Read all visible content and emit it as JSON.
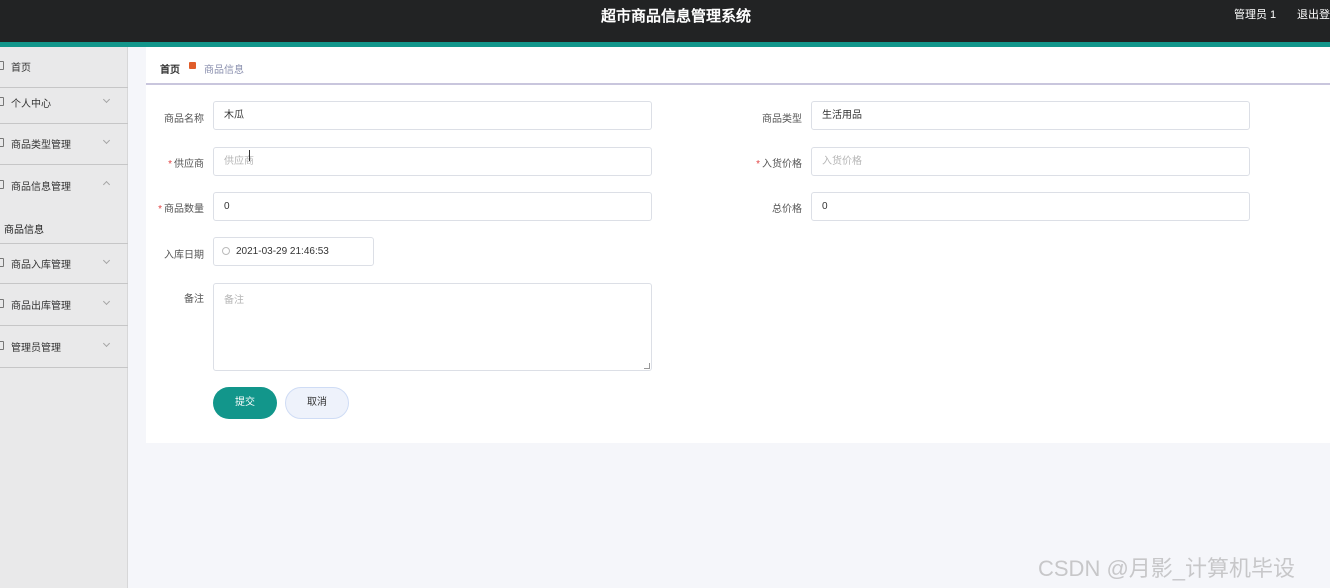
{
  "header": {
    "title": "超市商品信息管理系统",
    "user": "管理员 1",
    "logout": "退出登录"
  },
  "sidebar": {
    "items": [
      {
        "label": "首页",
        "icon": "home-icon"
      },
      {
        "label": "个人中心",
        "icon": "user-icon"
      },
      {
        "label": "商品类型管理",
        "icon": "grid-icon"
      },
      {
        "label": "商品信息管理",
        "icon": "document-icon",
        "expanded": true
      },
      {
        "label": "商品入库管理",
        "icon": "inbox-icon"
      },
      {
        "label": "商品出库管理",
        "icon": "outbox-icon"
      },
      {
        "label": "管理员管理",
        "icon": "admin-icon"
      }
    ],
    "submenu": {
      "label": "商品信息"
    }
  },
  "breadcrumb": {
    "home": "首页",
    "current": "商品信息"
  },
  "form": {
    "name": {
      "label": "商品名称",
      "value": "木瓜"
    },
    "type": {
      "label": "商品类型",
      "value": "生活用品"
    },
    "supplier": {
      "label": "供应商",
      "placeholder": "供应商",
      "required": true
    },
    "purchase_price": {
      "label": "入货价格",
      "placeholder": "入货价格",
      "required": true
    },
    "quantity": {
      "label": "商品数量",
      "value": "0",
      "required": true
    },
    "total_price": {
      "label": "总价格",
      "value": "0"
    },
    "date": {
      "label": "入库日期",
      "value": "2021-03-29 21:46:53"
    },
    "remark": {
      "label": "备注",
      "placeholder": "备注"
    },
    "submit": "提交",
    "cancel": "取消"
  },
  "watermark": "CSDN @月影_计算机毕设",
  "colors": {
    "accent": "#12968b",
    "topbar": "#222324",
    "required": "#e24343"
  }
}
